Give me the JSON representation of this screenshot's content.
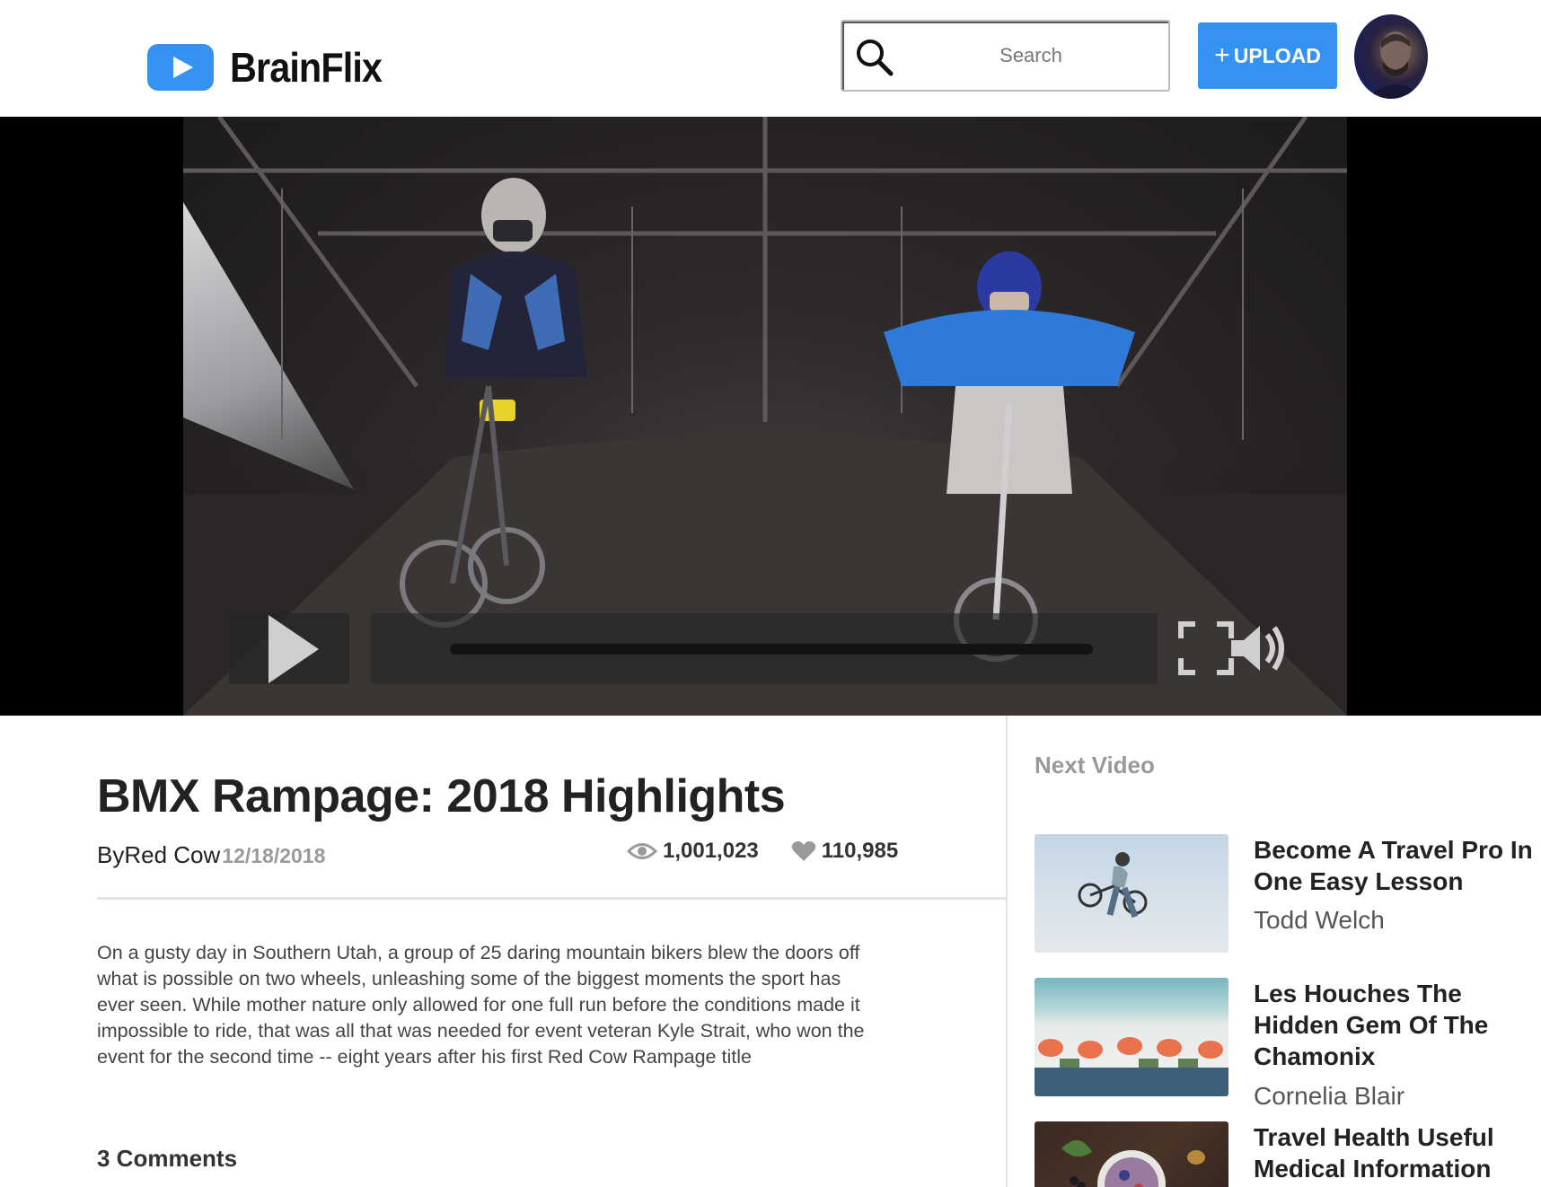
{
  "app": {
    "name": "BrainFlix"
  },
  "header": {
    "search_placeholder": "Search",
    "upload_label": "UPLOAD",
    "upload_plus": "+"
  },
  "player": {
    "progress": 0.0
  },
  "video": {
    "title": "BMX Rampage: 2018 Highlights",
    "by_prefix": "By ",
    "channel": "Red Cow",
    "date": "12/18/2018",
    "views": "1,001,023",
    "likes": "110,985",
    "description": "On a gusty day in Southern Utah, a group of 25 daring mountain bikers blew the doors off what is possible on two wheels, unleashing some of the biggest moments the sport has ever seen. While mother nature only allowed for one full run before the conditions made it impossible to ride, that was all that was needed for event veteran Kyle Strait, who won the event for the second time -- eight years after his first Red Cow Rampage title",
    "comments_label": "3 Comments"
  },
  "sidebar": {
    "heading": "Next Video",
    "items": [
      {
        "title": "Become A Travel Pro In One Easy Lesson",
        "author": "Todd Welch"
      },
      {
        "title": "Les Houches The Hidden Gem Of The Chamonix",
        "author": "Cornelia Blair"
      },
      {
        "title": "Travel Health Useful Medical Information",
        "author": ""
      }
    ]
  },
  "colors": {
    "accent": "#3592f0",
    "muted": "#9a9a9a"
  }
}
